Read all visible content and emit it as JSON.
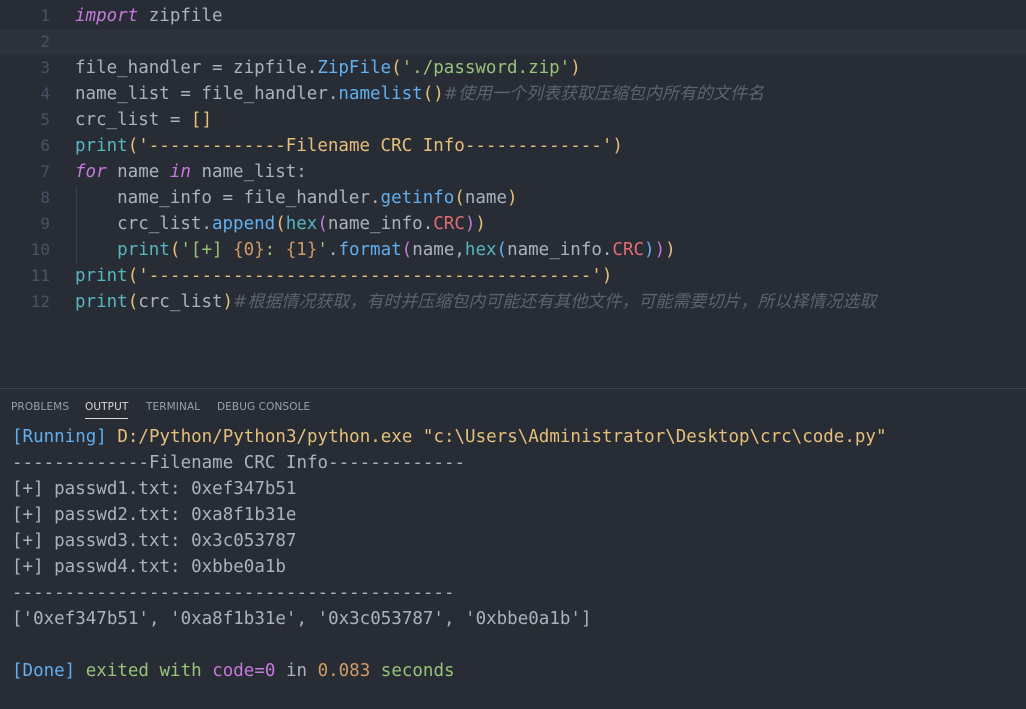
{
  "editor": {
    "lines": [
      {
        "num": "1",
        "parts": [
          {
            "t": "import",
            "c": "kw"
          },
          {
            "t": " zipfile",
            "c": "txt"
          }
        ]
      },
      {
        "num": "2",
        "parts": []
      },
      {
        "num": "3",
        "parts": [
          {
            "t": "file_handler = zipfile.",
            "c": "txt"
          },
          {
            "t": "ZipFile",
            "c": "fn"
          },
          {
            "t": "(",
            "c": "br"
          },
          {
            "t": "'./password.zip'",
            "c": "str"
          },
          {
            "t": ")",
            "c": "br"
          }
        ]
      },
      {
        "num": "4",
        "parts": [
          {
            "t": "name_list = file_handler.",
            "c": "txt"
          },
          {
            "t": "namelist",
            "c": "fn"
          },
          {
            "t": "()",
            "c": "br"
          },
          {
            "t": "#使用一个列表获取压缩包内所有的文件名",
            "c": "cm"
          }
        ]
      },
      {
        "num": "5",
        "parts": [
          {
            "t": "crc_list = ",
            "c": "txt"
          },
          {
            "t": "[]",
            "c": "br"
          }
        ]
      },
      {
        "num": "6",
        "parts": [
          {
            "t": "print",
            "c": "bi"
          },
          {
            "t": "(",
            "c": "br"
          },
          {
            "t": "'-------------Filename CRC Info-------------'",
            "c": "str2"
          },
          {
            "t": ")",
            "c": "br"
          }
        ]
      },
      {
        "num": "7",
        "parts": [
          {
            "t": "for",
            "c": "kw"
          },
          {
            "t": " name ",
            "c": "txt"
          },
          {
            "t": "in",
            "c": "kw"
          },
          {
            "t": " name_list:",
            "c": "txt"
          }
        ]
      },
      {
        "num": "8",
        "parts": [
          {
            "t": "    name_info = file_handler.",
            "c": "txt"
          },
          {
            "t": "getinfo",
            "c": "fn"
          },
          {
            "t": "(",
            "c": "br"
          },
          {
            "t": "name",
            "c": "txt"
          },
          {
            "t": ")",
            "c": "br"
          }
        ]
      },
      {
        "num": "9",
        "parts": [
          {
            "t": "    crc_list.",
            "c": "txt"
          },
          {
            "t": "append",
            "c": "fn"
          },
          {
            "t": "(",
            "c": "br"
          },
          {
            "t": "hex",
            "c": "bi"
          },
          {
            "t": "(",
            "c": "br2"
          },
          {
            "t": "name_info.",
            "c": "txt"
          },
          {
            "t": "CRC",
            "c": "var"
          },
          {
            "t": ")",
            "c": "br2"
          },
          {
            "t": ")",
            "c": "br"
          }
        ]
      },
      {
        "num": "10",
        "parts": [
          {
            "t": "    print",
            "c": "bi"
          },
          {
            "t": "(",
            "c": "br"
          },
          {
            "t": "'[+] ",
            "c": "str"
          },
          {
            "t": "{0}",
            "c": "num"
          },
          {
            "t": ": ",
            "c": "str"
          },
          {
            "t": "{1}",
            "c": "num"
          },
          {
            "t": "'",
            "c": "str"
          },
          {
            "t": ".",
            "c": "txt"
          },
          {
            "t": "format",
            "c": "fn"
          },
          {
            "t": "(",
            "c": "br2"
          },
          {
            "t": "name,",
            "c": "txt"
          },
          {
            "t": "hex",
            "c": "bi"
          },
          {
            "t": "(",
            "c": "br3"
          },
          {
            "t": "name_info.",
            "c": "txt"
          },
          {
            "t": "CRC",
            "c": "var"
          },
          {
            "t": ")",
            "c": "br3"
          },
          {
            "t": ")",
            "c": "br2"
          },
          {
            "t": ")",
            "c": "br"
          }
        ]
      },
      {
        "num": "11",
        "parts": [
          {
            "t": "print",
            "c": "bi"
          },
          {
            "t": "(",
            "c": "br"
          },
          {
            "t": "'------------------------------------------'",
            "c": "str2"
          },
          {
            "t": ")",
            "c": "br"
          }
        ]
      },
      {
        "num": "12",
        "parts": [
          {
            "t": "print",
            "c": "bi"
          },
          {
            "t": "(",
            "c": "br"
          },
          {
            "t": "crc_list",
            "c": "txt"
          },
          {
            "t": ")",
            "c": "br"
          },
          {
            "t": "#根据情况获取，有时并压缩包内可能还有其他文件，可能需要切片，所以择情况选取",
            "c": "cm"
          }
        ]
      }
    ]
  },
  "panel": {
    "tabs": [
      "PROBLEMS",
      "OUTPUT",
      "TERMINAL",
      "DEBUG CONSOLE"
    ],
    "active_tab": "OUTPUT",
    "output": {
      "running_tag": "[Running]",
      "running_cmd": " D:/Python/Python3/python.exe \"c:\\Users\\Administrator\\Desktop\\crc\\code.py\"",
      "header": "-------------Filename CRC Info-------------",
      "entries": [
        "[+] passwd1.txt: 0xef347b51",
        "[+] passwd2.txt: 0xa8f1b31e",
        "[+] passwd3.txt: 0x3c053787",
        "[+] passwd4.txt: 0xbbe0a1b"
      ],
      "footer": "------------------------------------------",
      "list": "['0xef347b51', '0xa8f1b31e', '0x3c053787', '0xbbe0a1b']",
      "done_tag": "[Done]",
      "done_exited": " exited with ",
      "done_code": "code=0",
      "done_in": " in ",
      "done_time": "0.083",
      "done_seconds": " seconds"
    }
  }
}
